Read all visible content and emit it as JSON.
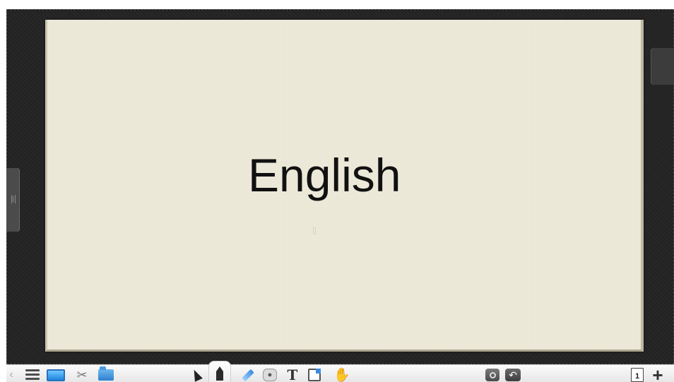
{
  "canvas": {
    "page_text": "English"
  },
  "toolbar": {
    "left": [
      {
        "name": "collapse-chevron-icon",
        "glyph": "‹"
      },
      {
        "name": "menu-icon"
      },
      {
        "name": "display-icon"
      },
      {
        "name": "tools-icon",
        "glyph": "✂"
      },
      {
        "name": "resources-icon"
      }
    ],
    "center": [
      {
        "name": "select-arrow-icon"
      },
      {
        "name": "pencil-icon",
        "active": true
      },
      {
        "name": "highlighter-icon"
      },
      {
        "name": "eraser-icon"
      },
      {
        "name": "text-icon",
        "glyph": "T"
      },
      {
        "name": "shape-icon"
      },
      {
        "name": "hand-icon",
        "glyph": "✋"
      }
    ],
    "right": [
      {
        "name": "screen-capture-icon"
      },
      {
        "name": "undo-icon",
        "glyph": "↶"
      }
    ],
    "page_indicator": "1",
    "add_glyph": "+"
  },
  "colors": {
    "board": "#232323",
    "page": "#ebe8d8",
    "accent": "#2a6fb8"
  }
}
